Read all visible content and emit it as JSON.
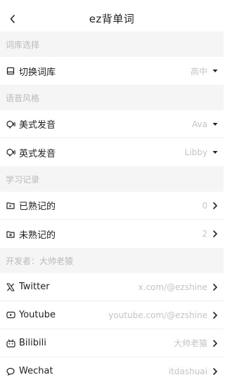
{
  "nav": {
    "title": "ez背单词"
  },
  "sections": {
    "library": "词库选择",
    "voice": "语音风格",
    "records": "学习记录",
    "developer": "开发者：大帅老猿"
  },
  "library": {
    "switch_label": "切换词库",
    "switch_value": "高中"
  },
  "voice": {
    "us_label": "美式发音",
    "us_value": "Ava",
    "uk_label": "英式发音",
    "uk_value": "Libby"
  },
  "records": {
    "known_label": "已熟记的",
    "known_count": "0",
    "unknown_label": "未熟记的",
    "unknown_count": "2"
  },
  "developer": {
    "twitter_label": "Twitter",
    "twitter_value": "x.com/@ezshine",
    "youtube_label": "Youtube",
    "youtube_value": "youtube.com/@ezshine",
    "bilibili_label": "Bilibili",
    "bilibili_value": "大帅老猿",
    "wechat_label": "Wechat",
    "wechat_value": "itdashuai"
  },
  "icons": {
    "back": "chevron-left-icon",
    "library": "book-icon",
    "voice": "speech-icon",
    "known": "folder-check-icon",
    "unknown": "folder-x-icon",
    "twitter": "x-logo-icon",
    "youtube": "youtube-icon",
    "bilibili": "bilibili-icon",
    "wechat": "chat-bubble-icon",
    "dropdown": "caret-down-icon",
    "chevron": "chevron-right-icon"
  },
  "colors": {
    "section_bg": "#f5f5f5",
    "muted_text": "#c4c4c4",
    "text": "#1f1f1f"
  }
}
